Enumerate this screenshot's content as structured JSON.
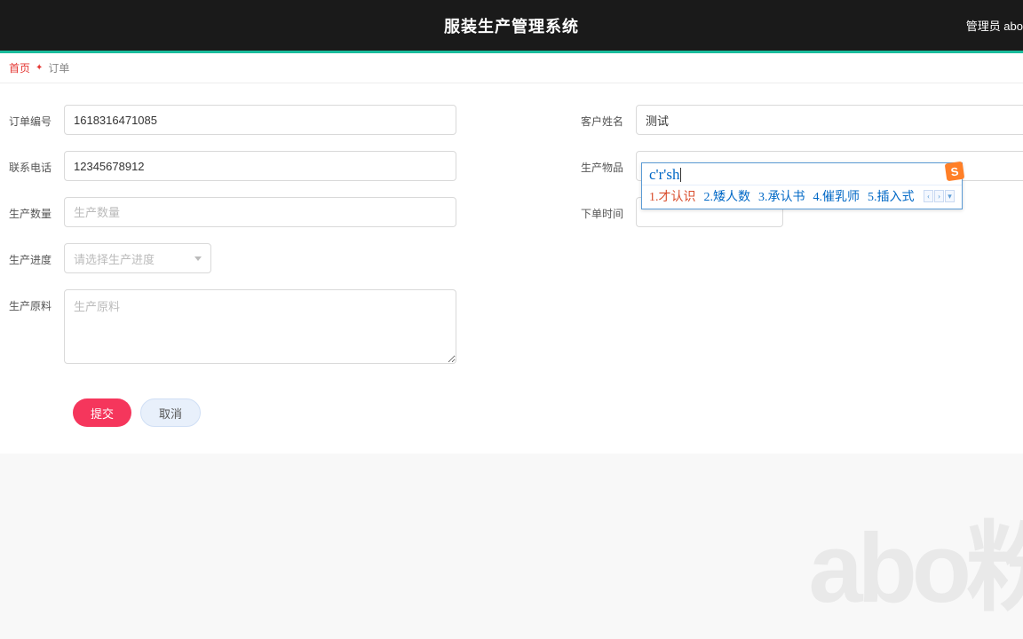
{
  "header": {
    "title": "服装生产管理系统",
    "user": "管理员 abo"
  },
  "breadcrumb": {
    "home": "首页",
    "current": "订单"
  },
  "form": {
    "left": {
      "orderNo": {
        "label": "订单编号",
        "value": "1618316471085"
      },
      "phone": {
        "label": "联系电话",
        "value": "12345678912"
      },
      "qty": {
        "label": "生产数量",
        "placeholder": "生产数量"
      },
      "progress": {
        "label": "生产进度",
        "placeholder": "请选择生产进度"
      },
      "material": {
        "label": "生产原料",
        "placeholder": "生产原料"
      }
    },
    "right": {
      "customer": {
        "label": "客户姓名",
        "value": "测试"
      },
      "product": {
        "label": "生产物品",
        "value": ""
      },
      "orderTime": {
        "label": "下单时间"
      }
    },
    "actions": {
      "submit": "提交",
      "cancel": "取消"
    }
  },
  "ime": {
    "composition": "c'r'sh",
    "candidates": [
      {
        "n": "1.",
        "t": "才认识"
      },
      {
        "n": "2.",
        "t": "矮人数"
      },
      {
        "n": "3.",
        "t": "承认书"
      },
      {
        "n": "4.",
        "t": "催乳师"
      },
      {
        "n": "5.",
        "t": "插入式"
      }
    ],
    "logo": "S"
  },
  "watermark": "abo粉"
}
